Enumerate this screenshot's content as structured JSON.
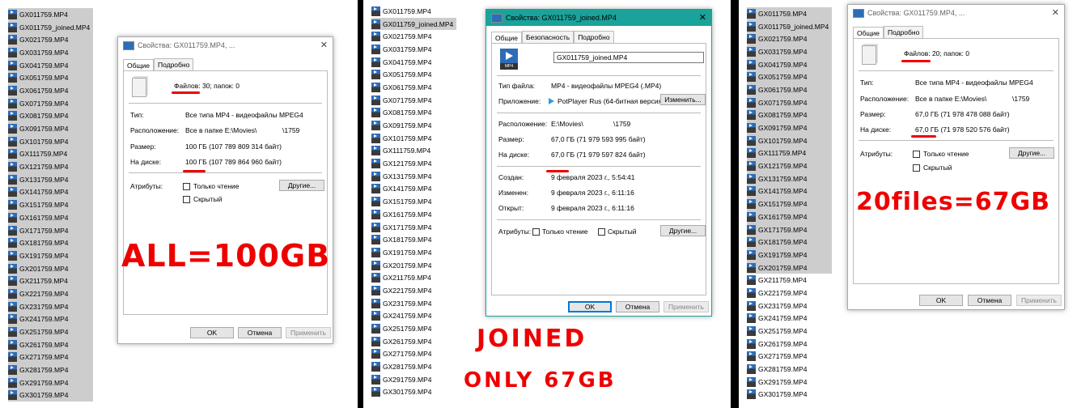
{
  "files": {
    "panel1": [
      "GX011759.MP4",
      "GX011759_joined.MP4",
      "GX021759.MP4",
      "GX031759.MP4",
      "GX041759.MP4",
      "GX051759.MP4",
      "GX061759.MP4",
      "GX071759.MP4",
      "GX081759.MP4",
      "GX091759.MP4",
      "GX101759.MP4",
      "GX111759.MP4",
      "GX121759.MP4",
      "GX131759.MP4",
      "GX141759.MP4",
      "GX151759.MP4",
      "GX161759.MP4",
      "GX171759.MP4",
      "GX181759.MP4",
      "GX191759.MP4",
      "GX201759.MP4",
      "GX211759.MP4",
      "GX221759.MP4",
      "GX231759.MP4",
      "GX241759.MP4",
      "GX251759.MP4",
      "GX261759.MP4",
      "GX271759.MP4",
      "GX281759.MP4",
      "GX291759.MP4",
      "GX301759.MP4"
    ],
    "panel2": [
      "GX011759.MP4",
      "GX011759_joined.MP4",
      "GX021759.MP4",
      "GX031759.MP4",
      "GX041759.MP4",
      "GX051759.MP4",
      "GX061759.MP4",
      "GX071759.MP4",
      "GX081759.MP4",
      "GX091759.MP4",
      "GX101759.MP4",
      "GX111759.MP4",
      "GX121759.MP4",
      "GX131759.MP4",
      "GX141759.MP4",
      "GX151759.MP4",
      "GX161759.MP4",
      "GX171759.MP4",
      "GX181759.MP4",
      "GX191759.MP4",
      "GX201759.MP4",
      "GX211759.MP4",
      "GX221759.MP4",
      "GX231759.MP4",
      "GX241759.MP4",
      "GX251759.MP4",
      "GX261759.MP4",
      "GX271759.MP4",
      "GX281759.MP4",
      "GX291759.MP4",
      "GX301759.MP4"
    ],
    "panel3": [
      "GX011759.MP4",
      "GX011759_joined.MP4",
      "GX021759.MP4",
      "GX031759.MP4",
      "GX041759.MP4",
      "GX051759.MP4",
      "GX061759.MP4",
      "GX071759.MP4",
      "GX081759.MP4",
      "GX091759.MP4",
      "GX101759.MP4",
      "GX111759.MP4",
      "GX121759.MP4",
      "GX131759.MP4",
      "GX141759.MP4",
      "GX151759.MP4",
      "GX161759.MP4",
      "GX171759.MP4",
      "GX181759.MP4",
      "GX191759.MP4",
      "GX201759.MP4",
      "GX211759.MP4",
      "GX221759.MP4",
      "GX231759.MP4",
      "GX241759.MP4",
      "GX251759.MP4",
      "GX261759.MP4",
      "GX271759.MP4",
      "GX281759.MP4",
      "GX291759.MP4",
      "GX301759.MP4"
    ],
    "selected_panel1": [
      0,
      1,
      2,
      3,
      4,
      5,
      6,
      7,
      8,
      9,
      10,
      11,
      12,
      13,
      14,
      15,
      16,
      17,
      18,
      19,
      20,
      21,
      22,
      23,
      24,
      25,
      26,
      27,
      28,
      29,
      30
    ],
    "selected_panel2": [
      1
    ],
    "selected_panel3": [
      0,
      1,
      2,
      3,
      4,
      5,
      6,
      7,
      8,
      9,
      10,
      11,
      12,
      13,
      14,
      15,
      16,
      17,
      18,
      19,
      20
    ]
  },
  "dialog1": {
    "title": "Свойства: GX011759.MP4, ...",
    "close": "✕",
    "tabs": [
      "Общие",
      "Подробно"
    ],
    "summary": "Файлов: 30; папок: 0",
    "type_label": "Тип:",
    "type_value": "Все типа MP4 - видеофайлы MPEG4",
    "location_label": "Расположение:",
    "location_value": "Все в папке E:\\Movies\\",
    "location_suffix": "\\1759",
    "size_label": "Размер:",
    "size_value": "100 ГБ (107 789 809 314 байт)",
    "disk_label": "На диске:",
    "disk_value": "100 ГБ (107 789 864 960 байт)",
    "attributes_label": "Атрибуты:",
    "readonly": "Только чтение",
    "hidden": "Скрытый",
    "other_button": "Другие...",
    "ok": "OK",
    "cancel": "Отмена",
    "apply": "Применить"
  },
  "dialog2": {
    "title": "Свойства: GX011759_joined.MP4",
    "close": "✕",
    "tabs": [
      "Общие",
      "Безопасность",
      "Подробно"
    ],
    "icon_label": "MP4",
    "filename": "GX011759_joined.MP4",
    "filetype_label": "Тип файла:",
    "filetype_value": "MP4 - видеофайлы MPEG4 (.MP4)",
    "app_label": "Приложение:",
    "app_value": "PotPlayer Rus (64-битная версия",
    "change_button": "Изменить...",
    "location_label": "Расположение:",
    "location_value": "E:\\Movies\\",
    "location_suffix": "\\1759",
    "size_label": "Размер:",
    "size_value": "67,0 ГБ (71 979 593 995 байт)",
    "disk_label": "На диске:",
    "disk_value": "67,0 ГБ (71 979 597 824 байт)",
    "created_label": "Создан:",
    "created_value": "9 февраля 2023 г., 5:54:41",
    "modified_label": "Изменен:",
    "modified_value": "9 февраля 2023 г., 6:11:16",
    "opened_label": "Открыт:",
    "opened_value": "9 февраля 2023 г., 6:11:16",
    "attributes_label": "Атрибуты:",
    "readonly": "Только чтение",
    "hidden": "Скрытый",
    "other_button": "Другие...",
    "ok": "OK",
    "cancel": "Отмена",
    "apply": "Применить"
  },
  "dialog3": {
    "title": "Свойства: GX011759.MP4, ...",
    "close": "✕",
    "tabs": [
      "Общие",
      "Подробно"
    ],
    "summary": "Файлов: 20; папок: 0",
    "type_label": "Тип:",
    "type_value": "Все типа MP4 - видеофайлы MPEG4",
    "location_label": "Расположение:",
    "location_value": "Все в папке E:\\Movies\\",
    "location_suffix": "\\1759",
    "size_label": "Размер:",
    "size_value": "67,0 ГБ (71 978 478 088 байт)",
    "disk_label": "На диске:",
    "disk_value": "67,0 ГБ (71 978 520 576 байт)",
    "attributes_label": "Атрибуты:",
    "readonly": "Только чтение",
    "hidden": "Скрытый",
    "other_button": "Другие...",
    "ok": "OK",
    "cancel": "Отмена",
    "apply": "Применить"
  },
  "annotations": {
    "all": "ALL=100GB",
    "joined_line1": "JOINED",
    "joined_line2": "ONLY 67GB",
    "twenty": "20files=67GB"
  },
  "colors": {
    "annotation": "#e00000",
    "active_title": "#1aa39a",
    "selection": "#cdcdcd"
  }
}
